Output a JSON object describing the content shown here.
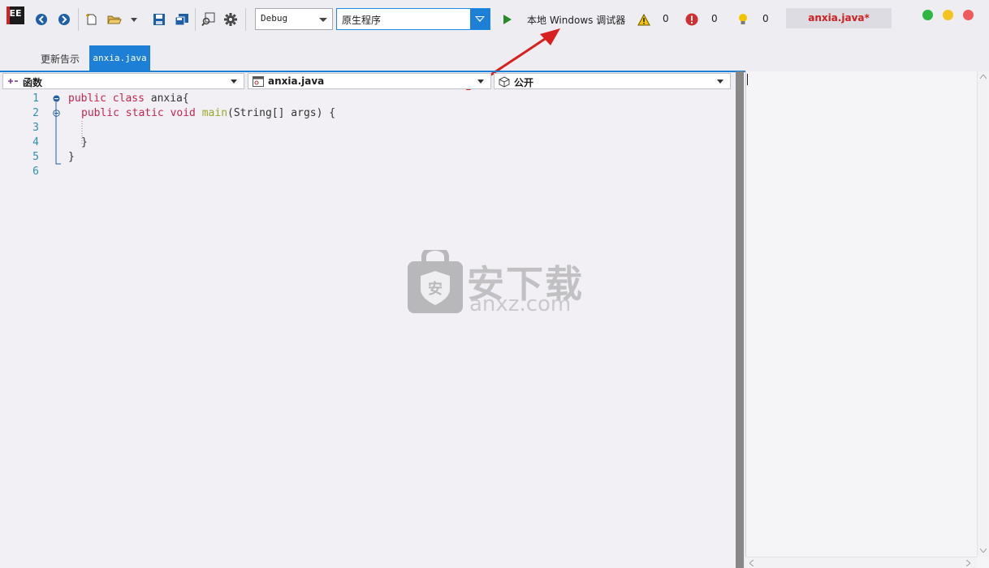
{
  "app": {
    "logo_text": "EE",
    "file_badge": "anxia.java*"
  },
  "toolbar": {
    "config_value": "Debug",
    "platform_value": "原生程序",
    "run_label": "本地 Windows 调试器",
    "warnings_count": "0",
    "errors_count": "0",
    "messages_count": "0",
    "icons": [
      "back-icon",
      "forward-icon",
      "new-file-icon",
      "open-folder-icon",
      "save-icon",
      "save-all-icon",
      "find-icon",
      "gear-icon",
      "play-icon",
      "warning-icon",
      "error-icon",
      "lightbulb-icon"
    ]
  },
  "tabs": {
    "update_label": "更新告示",
    "active_label": "anxia.java"
  },
  "navbar": {
    "scope_label": "函数",
    "file_label": "anxia.java",
    "access_label": "公开"
  },
  "editor": {
    "line_numbers": [
      "1",
      "2",
      "3",
      "4",
      "5",
      "6"
    ],
    "lines": {
      "l1_kw": "public class ",
      "l1_rest": "anxia{",
      "l2_kw": "public static void ",
      "l2_fn": "main",
      "l2_rest": "(String[] args) {",
      "l4": "}",
      "l5": "}"
    }
  },
  "watermark": {
    "title": "安下载",
    "subtitle": "anxz.com"
  },
  "colors": {
    "accent": "#1e7fd6",
    "badge_text": "#d21e1e",
    "keyword": "#c7254e",
    "function": "#9aaa2a",
    "line_number": "#2b91af"
  }
}
